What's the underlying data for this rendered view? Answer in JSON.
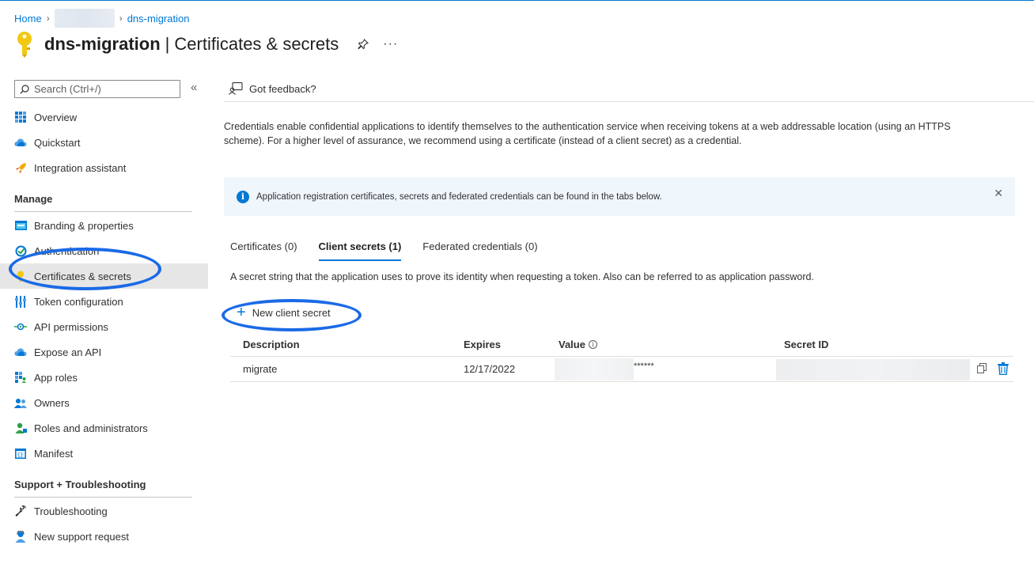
{
  "breadcrumb": {
    "home": "Home",
    "current": "dns-migration"
  },
  "header": {
    "app_name": "dns-migration",
    "separator": "|",
    "page_title": "Certificates & secrets",
    "more": "···"
  },
  "sidebar": {
    "search_placeholder": "Search (Ctrl+/)",
    "collapse": "«",
    "items_top": [
      {
        "label": "Overview",
        "icon": "grid-icon"
      },
      {
        "label": "Quickstart",
        "icon": "cloud-icon"
      },
      {
        "label": "Integration assistant",
        "icon": "rocket-icon"
      }
    ],
    "manage_heading": "Manage",
    "manage_items": [
      {
        "label": "Branding & properties",
        "icon": "branding-icon"
      },
      {
        "label": "Authentication",
        "icon": "authentication-icon"
      },
      {
        "label": "Certificates & secrets",
        "icon": "key-icon",
        "active": true
      },
      {
        "label": "Token configuration",
        "icon": "token-icon"
      },
      {
        "label": "API permissions",
        "icon": "api-permissions-icon"
      },
      {
        "label": "Expose an API",
        "icon": "cloud-icon"
      },
      {
        "label": "App roles",
        "icon": "app-roles-icon"
      },
      {
        "label": "Owners",
        "icon": "users-icon"
      },
      {
        "label": "Roles and administrators",
        "icon": "user-roles-icon"
      },
      {
        "label": "Manifest",
        "icon": "manifest-icon"
      }
    ],
    "support_heading": "Support + Troubleshooting",
    "support_items": [
      {
        "label": "Troubleshooting",
        "icon": "wrench-icon"
      },
      {
        "label": "New support request",
        "icon": "support-person-icon"
      }
    ]
  },
  "content": {
    "feedback_label": "Got feedback?",
    "description": "Credentials enable confidential applications to identify themselves to the authentication service when receiving tokens at a web addressable location (using an HTTPS scheme). For a higher level of assurance, we recommend using a certificate (instead of a client secret) as a credential.",
    "info_message": "Application registration certificates, secrets and federated credentials can be found in the tabs below.",
    "info_close": "✕",
    "tabs": [
      {
        "label": "Certificates (0)",
        "active": false
      },
      {
        "label": "Client secrets (1)",
        "active": true
      },
      {
        "label": "Federated credentials (0)",
        "active": false
      }
    ],
    "secret_description": "A secret string that the application uses to prove its identity when requesting a token. Also can be referred to as application password.",
    "new_secret_label": "New client secret",
    "table": {
      "headers": {
        "description": "Description",
        "expires": "Expires",
        "value": "Value",
        "secret_id": "Secret ID"
      },
      "rows": [
        {
          "description": "migrate",
          "expires": "12/17/2022",
          "value_masked": "******"
        }
      ]
    }
  },
  "colors": {
    "accent": "#0078d4",
    "highlight_ring": "#1a6ae6",
    "active_nav": "#e6e6e6",
    "info_bg": "#eff6fc"
  }
}
